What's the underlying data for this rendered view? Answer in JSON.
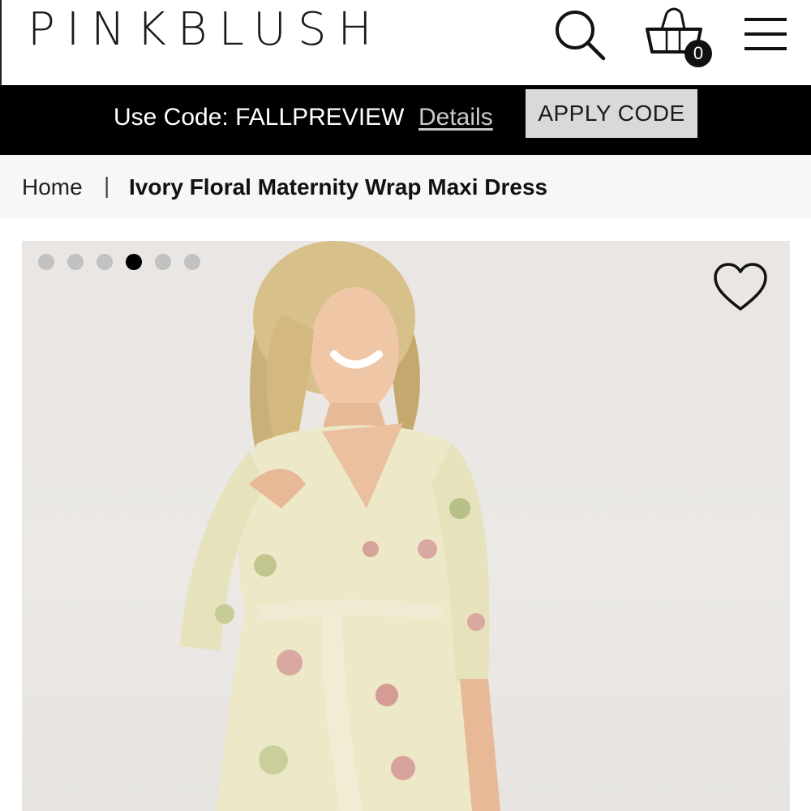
{
  "header": {
    "logo": "PINKBLUSH",
    "icons": [
      "search-icon",
      "shopping-bag-icon",
      "menu-icon"
    ],
    "cart_count": "0"
  },
  "promo": {
    "text": "Use Code: FALLPREVIEW",
    "details_link": "Details",
    "apply_button": "APPLY CODE",
    "colors": {
      "bar": "#000000",
      "button": "#d9d9d9"
    }
  },
  "breadcrumb": {
    "home": "Home",
    "separator": "|",
    "current": "Ivory Floral Maternity Wrap Maxi Dress"
  },
  "gallery": {
    "image_count": 6,
    "active_index": 3,
    "icons": [
      "heart-icon"
    ]
  }
}
